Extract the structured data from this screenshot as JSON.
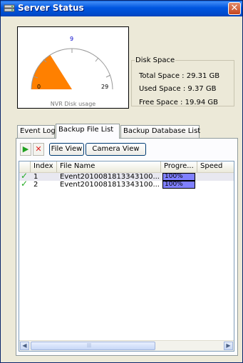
{
  "window": {
    "title": "Server Status",
    "close_glyph": "✕"
  },
  "gauge": {
    "caption": "NVR Disk usage",
    "scale_min": "0",
    "scale_mid": "9",
    "scale_max": "29",
    "used_gb": 9.37,
    "total_gb": 29.31,
    "fill_color": "#ff8000"
  },
  "disk": {
    "legend": "Disk Space",
    "total": "Total Space : 29.31 GB",
    "used": "Used Space : 9.37 GB",
    "free": "Free Space : 19.94 GB"
  },
  "tabs": [
    {
      "label": "Event Log",
      "active": false
    },
    {
      "label": "Backup File List",
      "active": true
    },
    {
      "label": "Backup Database List",
      "active": false
    }
  ],
  "toolbar": {
    "play_glyph": "▶",
    "delete_glyph": "✕",
    "file_view": "File View",
    "camera_view": "Camera View"
  },
  "columns": [
    "Index",
    "File Name",
    "Progre...",
    "Speed"
  ],
  "rows": [
    {
      "check": "✓",
      "index": "1",
      "file": "Event2010081813343100...",
      "progress_text": "100%",
      "progress": 1.0
    },
    {
      "check": "✓",
      "index": "2",
      "file": "Event2010081813343100...",
      "progress_text": "100%",
      "progress": 1.0
    }
  ],
  "scrollbar": {
    "left": "◀",
    "right": "▶",
    "grip": "|||"
  }
}
